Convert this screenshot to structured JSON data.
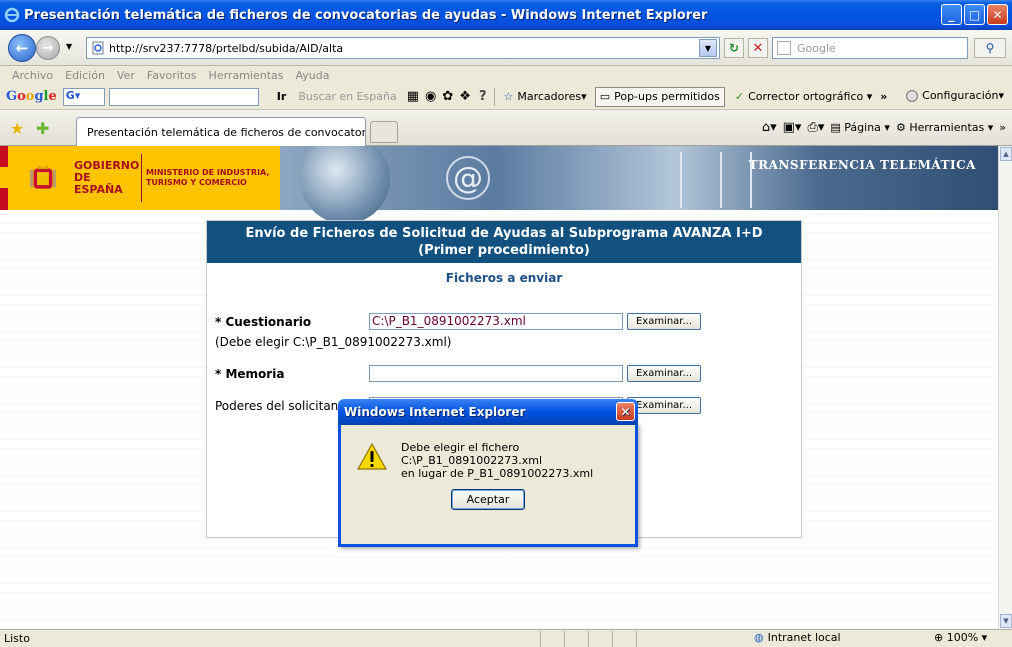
{
  "window": {
    "title": "Presentación telemática de ficheros de convocatorias de ayudas - Windows Internet Explorer",
    "controls": {
      "minimize": "_",
      "maximize": "□",
      "close": "✕"
    }
  },
  "address_bar": {
    "url": "http://srv237:7778/prtelbd/subida/AID/alta",
    "search_placeholder": "Google"
  },
  "menu": [
    "Archivo",
    "Edición",
    "Ver",
    "Favoritos",
    "Herramientas",
    "Ayuda"
  ],
  "google_toolbar": {
    "logo": [
      "G",
      "o",
      "o",
      "g",
      "l",
      "e"
    ],
    "dropdown": "G▾",
    "go_label": "Ir",
    "search_label": "Buscar en España",
    "marcadores": "Marcadores▾",
    "popups": "Pop-ups permitidos",
    "corrector": "Corrector ortográfico ▾",
    "more": "»",
    "config": "Configuración▾"
  },
  "tabs": [
    {
      "label": "Presentación telemática de ficheros de convocatorias ..."
    }
  ],
  "tab_toolbar": {
    "pagina": "Página ▾",
    "herramientas": "Herramientas ▾",
    "more": "»"
  },
  "banner": {
    "gov_name": "GOBIERNO DE ESPAÑA",
    "ministry": "MINISTERIO DE INDUSTRIA, TURISMO Y COMERCIO",
    "title": "TRANSFERENCIA TELEMÁTICA"
  },
  "form": {
    "heading": "Envío de Ficheros de Solicitud de Ayudas al Subprograma AVANZA I+D (Primer procedimiento)",
    "subheading": "Ficheros a enviar",
    "fields": [
      {
        "label": "* Cuestionario",
        "value": "C:\\P_B1_0891002273.xml",
        "button": "Examinar..."
      },
      {
        "label": "* Memoria",
        "value": "",
        "button": "Examinar..."
      },
      {
        "label": "Poderes del solicitante",
        "value": "",
        "button": "Examinar..."
      }
    ],
    "hint": "(Debe elegir C:\\P_B1_0891002273.xml)"
  },
  "dialog": {
    "title": "Windows Internet Explorer",
    "message_line1": "Debe elegir el fichero C:\\P_B1_0891002273.xml",
    "message_line2": "en lugar de P_B1_0891002273.xml",
    "ok_label": "Aceptar"
  },
  "status_bar": {
    "text": "Listo",
    "zone": "Intranet local",
    "zoom": "100%"
  },
  "colors": {
    "title_bar": "#0054e3",
    "form_header": "#11507f",
    "gov_yellow": "#ffc400",
    "gov_red": "#a8101d"
  }
}
